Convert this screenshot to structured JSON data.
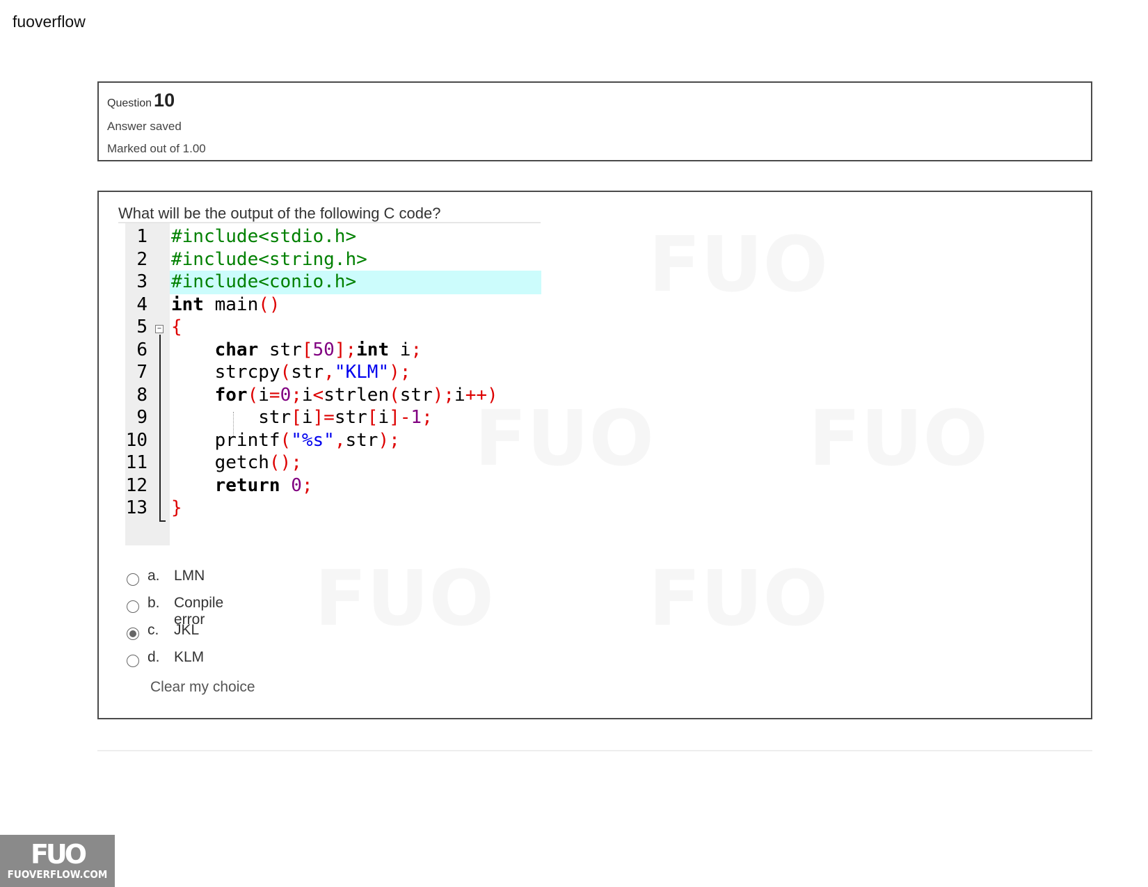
{
  "site": {
    "title": "fuoverflow"
  },
  "question": {
    "label": "Question",
    "number": "10",
    "status": "Answer saved",
    "marks": "Marked out of 1.00",
    "text": "What will be the output of the following C code?"
  },
  "code": {
    "line_numbers": [
      "1",
      "2",
      "3",
      "4",
      "5",
      "6",
      "7",
      "8",
      "9",
      "10",
      "11",
      "12",
      "13"
    ],
    "lines": [
      "#include<stdio.h>",
      "#include<string.h>",
      "#include<conio.h>",
      "int main()",
      "{",
      "    char str[50];int i;",
      "    strcpy(str,\"KLM\");",
      "    for(i=0;i<strlen(str);i++)",
      "        str[i]=str[i]-1;",
      "    printf(\"%s\",str);",
      "    getch();",
      "    return 0;",
      "}"
    ],
    "highlighted_line": 3
  },
  "options": [
    {
      "letter": "a.",
      "text": "LMN",
      "selected": false
    },
    {
      "letter": "b.",
      "text": "Conpile error",
      "selected": false
    },
    {
      "letter": "c.",
      "text": "JKL",
      "selected": true
    },
    {
      "letter": "d.",
      "text": "KLM",
      "selected": false
    }
  ],
  "clear_label": "Clear my choice",
  "watermark": {
    "logo": "FUO",
    "url": "FUOVERFLOW.COM"
  }
}
